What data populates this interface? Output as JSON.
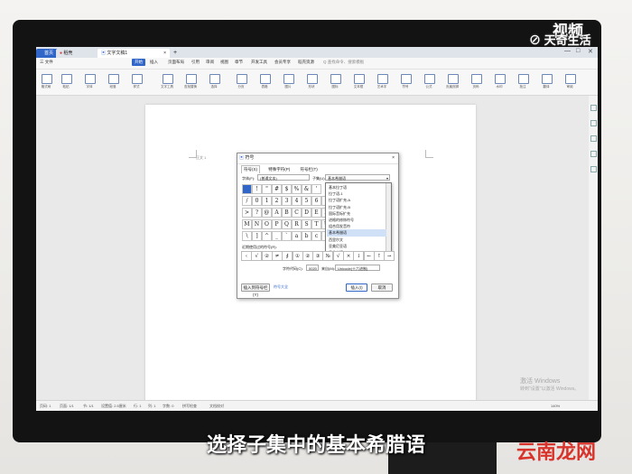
{
  "app": {
    "tabs": [
      {
        "label": "首页"
      },
      {
        "label": "稻壳"
      },
      {
        "label": "文字文稿1"
      }
    ],
    "new_tab": "+",
    "window_controls": [
      "—",
      "□",
      "✕"
    ]
  },
  "menu": {
    "items": [
      "三 文件",
      "开始",
      "插入",
      "页面布局",
      "引用",
      "审阅",
      "视图",
      "章节",
      "开发工具",
      "会员专享",
      "稻壳资源",
      "Q 查找命令、搜索模板"
    ],
    "active_index": 1
  },
  "ribbon": {
    "labels": [
      "格式刷",
      "粘贴",
      "字体",
      "段落",
      "样式",
      "文字工具",
      "查找替换",
      "选择",
      "分页",
      "表格",
      "图片",
      "形状",
      "图标",
      "文本框",
      "艺术字",
      "符号",
      "公式",
      "页眉页脚",
      "页码",
      "水印",
      "批注",
      "翻译",
      "审阅"
    ]
  },
  "document": {
    "marker": "正文 1"
  },
  "dialog": {
    "title": "符号",
    "tabs": [
      "符号(S)",
      "特殊字符(P)",
      "符号栏(T)"
    ],
    "font_label": "字体(F):",
    "font_value": "(普通文本)",
    "subset_label": "子集(U):",
    "subset_value": "基本希腊语",
    "grid_rows": [
      [
        " ",
        "!",
        "\"",
        "#",
        "$",
        "%",
        "&",
        "'"
      ],
      [
        "/",
        "0",
        "1",
        "2",
        "3",
        "4",
        "5",
        "6",
        "7"
      ],
      [
        ">",
        "?",
        "@",
        "A",
        "B",
        "C",
        "D",
        "E",
        "F"
      ],
      [
        "M",
        "N",
        "O",
        "P",
        "Q",
        "R",
        "S",
        "T",
        "U"
      ],
      [
        "\\",
        "]",
        "^",
        "_",
        "`",
        "a",
        "b",
        "c",
        "d"
      ]
    ],
    "dropdown_options": [
      "基本拉丁语",
      "拉丁语-1",
      "拉丁语扩充-A",
      "拉丁语扩充-B",
      "国际音标扩充",
      "进格的修饰符号",
      "组合用发音符",
      "基本希腊语",
      "西里尔文",
      "亚美尼亚语",
      "希伯来语"
    ],
    "dropdown_selected": 7,
    "recent_label": "近期使用过的符号(R):",
    "recent_symbols": [
      "‹",
      "√",
      "②",
      "≠",
      "∮",
      "①",
      "②",
      "③",
      "№",
      "√",
      "×",
      "↓",
      "←",
      "↑",
      "→"
    ],
    "code_label": "字符代码(C):",
    "code_value": "0020",
    "from_label": "来自(M):",
    "from_value": "Unicode(十六进制)",
    "shortcut_button": "插入到符号栏(Y)",
    "tip": "符号大全",
    "insert_button": "插入(I)",
    "cancel_button": "取消"
  },
  "statusbar": {
    "items": [
      "页码: 1",
      "页面: 1/1",
      "节: 1/1",
      "设置值: 2.5厘米",
      "行: 1",
      "列: 1",
      "字数: 0",
      "拼写检查",
      "文档校对"
    ],
    "zoom": "140%"
  },
  "overlay": {
    "watermark_top": "天奇生活",
    "watermark_top2": "视频",
    "caption": "选择子集中的基本希腊语",
    "site": "云南龙网",
    "activate_line1": "激活 Windows",
    "activate_line2": "转到\"设置\"以激活 Windows。"
  },
  "colors": {
    "accent": "#2f66c8",
    "bezel": "#131313"
  }
}
